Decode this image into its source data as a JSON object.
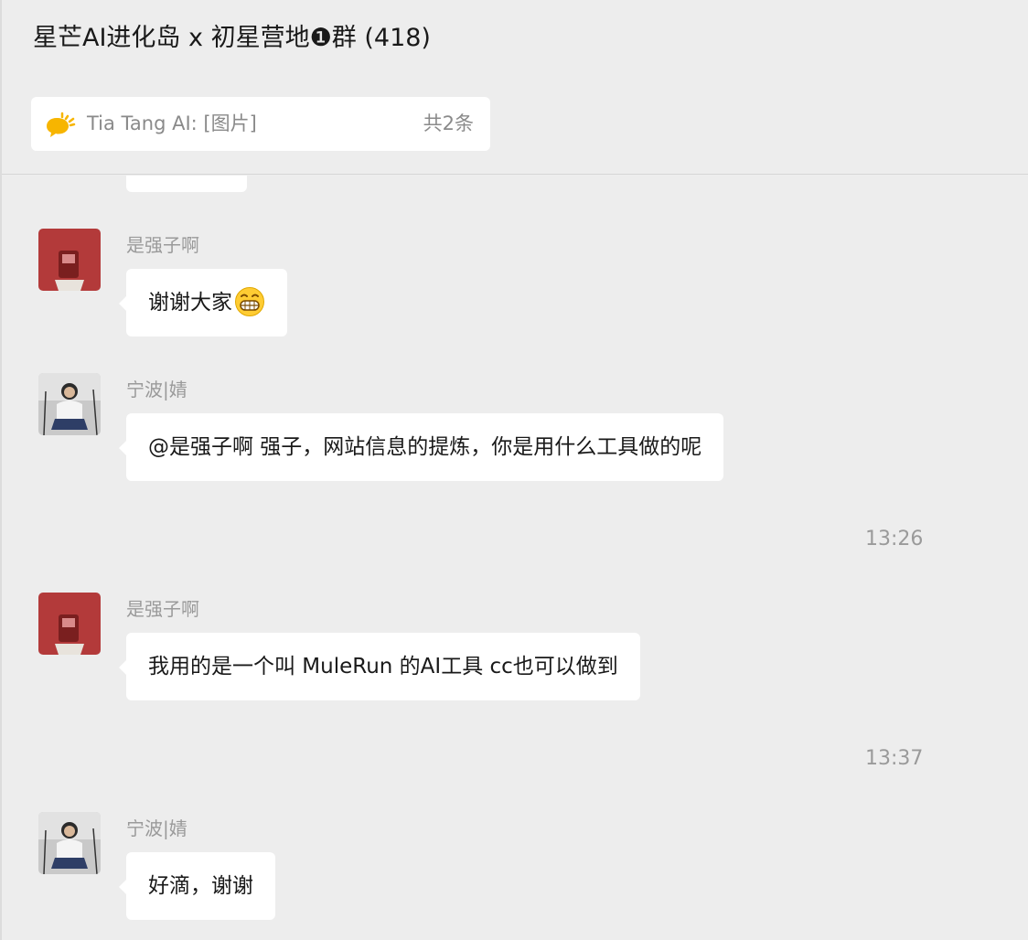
{
  "header": {
    "title": "星芒AI进化岛 x 初星营地❶群 (418)"
  },
  "pinned": {
    "text": "Tia Tang AI: [图片]",
    "count": "共2条",
    "icon": "speech-bubble-icon",
    "accent": "#f7b500"
  },
  "messages": [
    {
      "sender": "是强子啊",
      "avatar": "avatar-red",
      "text": "谢谢大家",
      "emoji": "grinning-face-icon"
    },
    {
      "sender": "宁波|婧",
      "avatar": "avatar-photo",
      "text": "@是强子啊 强子，网站信息的提炼，你是用什么工具做的呢"
    },
    {
      "timestamp": "13:26"
    },
    {
      "sender": "是强子啊",
      "avatar": "avatar-red",
      "text": "我用的是一个叫 MuleRun 的AI工具 cc也可以做到"
    },
    {
      "timestamp": "13:37"
    },
    {
      "sender": "宁波|婧",
      "avatar": "avatar-photo",
      "text": "好滴，谢谢"
    }
  ],
  "colors": {
    "background": "#ededed",
    "bubble": "#ffffff",
    "avatar_red": "#b33a3a"
  }
}
